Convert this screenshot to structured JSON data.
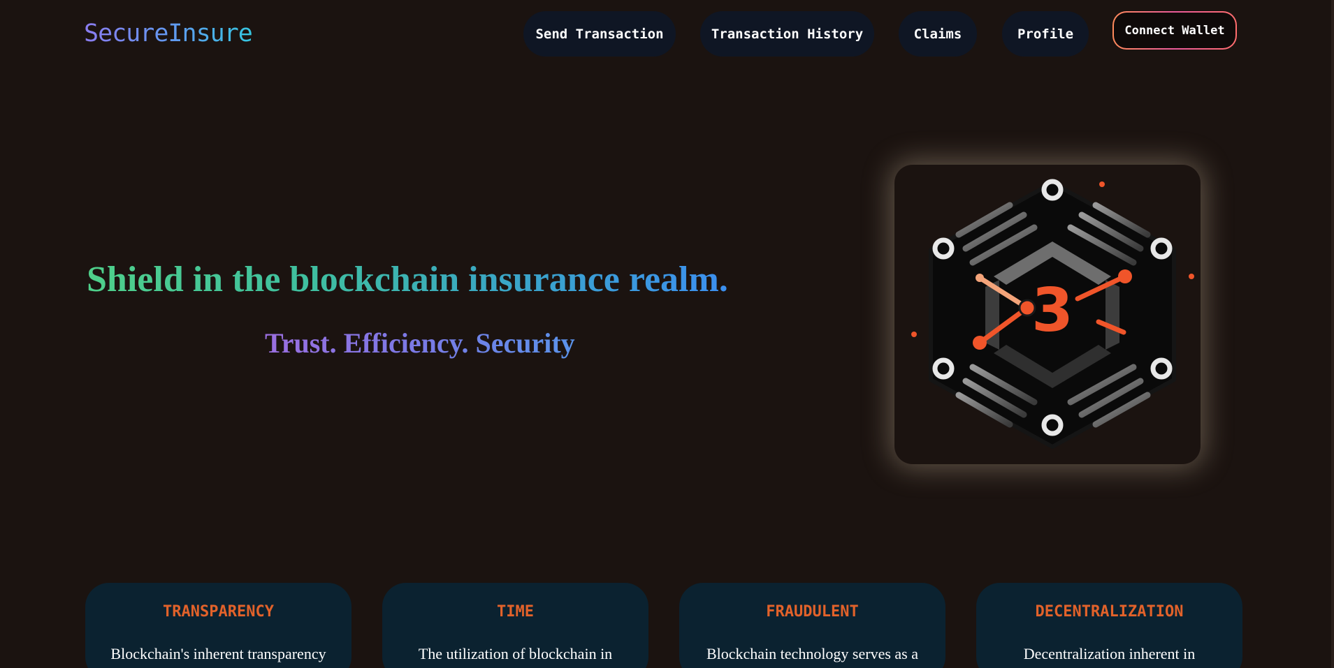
{
  "nav": {
    "brand": "SecureInsure",
    "send_transaction": "Send Transaction",
    "transaction_history": "Transaction History",
    "claims": "Claims",
    "profile": "Profile",
    "connect_wallet": "Connect Wallet"
  },
  "hero": {
    "title": "Shield in the blockchain insurance realm.",
    "subtitle": "Trust. Efficiency. Security",
    "logo_icon": "hexagon-blockchain-b-logo"
  },
  "features": [
    {
      "title": "TRANSPARENCY",
      "text": "Blockchain's inherent transparency"
    },
    {
      "title": "TIME",
      "text": "The utilization of blockchain in"
    },
    {
      "title": "FRAUDULENT",
      "text": "Blockchain technology serves as a"
    },
    {
      "title": "DECENTRALIZATION",
      "text": "Decentralization inherent in"
    }
  ],
  "colors": {
    "background": "#1b1310",
    "nav_button": "#0f1624",
    "card_background": "#0b2230",
    "card_title": "#e2622a",
    "accent_orange": "#f0552a"
  }
}
